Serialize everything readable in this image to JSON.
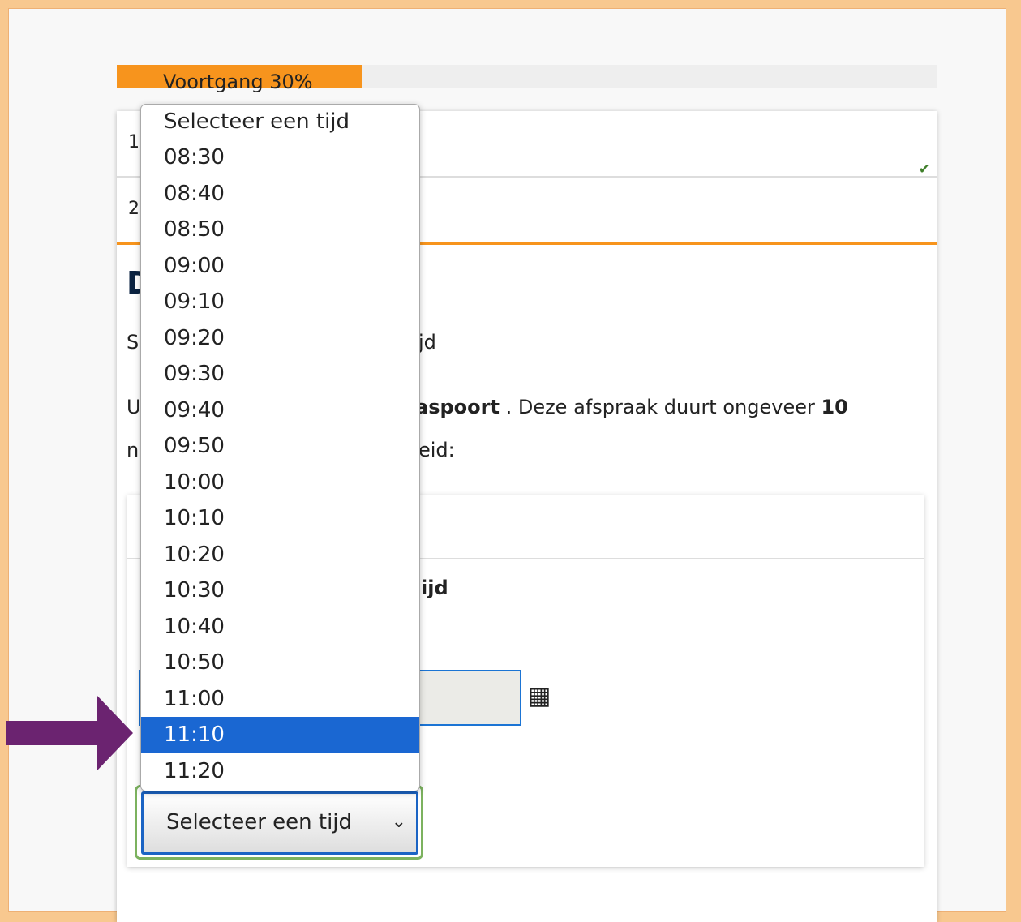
{
  "progress": {
    "label": "Voortgang 30%",
    "value": 0.3
  },
  "steps": [
    {
      "number": "1",
      "done": true,
      "check": "✔"
    },
    {
      "number": "2"
    }
  ],
  "heading_visible": "D",
  "text_fragments": {
    "line1": "S",
    "line1_right": "jd",
    "line2_left": "U",
    "line2_right_bold": "aspoort",
    "line2_right": " . Deze afspraak duurt ongeveer ",
    "line2_num": "10",
    "line3_left": "n",
    "line3_right": "eid:",
    "inner_title_right": "ijd"
  },
  "calendar_icon": "calendar-icon",
  "time_select": {
    "value": "Selecteer een tijd",
    "options": [
      "Selecteer een tijd",
      "08:30",
      "08:40",
      "08:50",
      "09:00",
      "09:10",
      "09:20",
      "09:30",
      "09:40",
      "09:50",
      "10:00",
      "10:10",
      "10:20",
      "10:30",
      "10:40",
      "10:50",
      "11:00",
      "11:10",
      "11:20"
    ],
    "highlighted": "11:10"
  },
  "colors": {
    "accent": "#f7941d",
    "highlight": "#1a67d2",
    "arrow": "#6b2370",
    "frame": "#f8c88f"
  }
}
